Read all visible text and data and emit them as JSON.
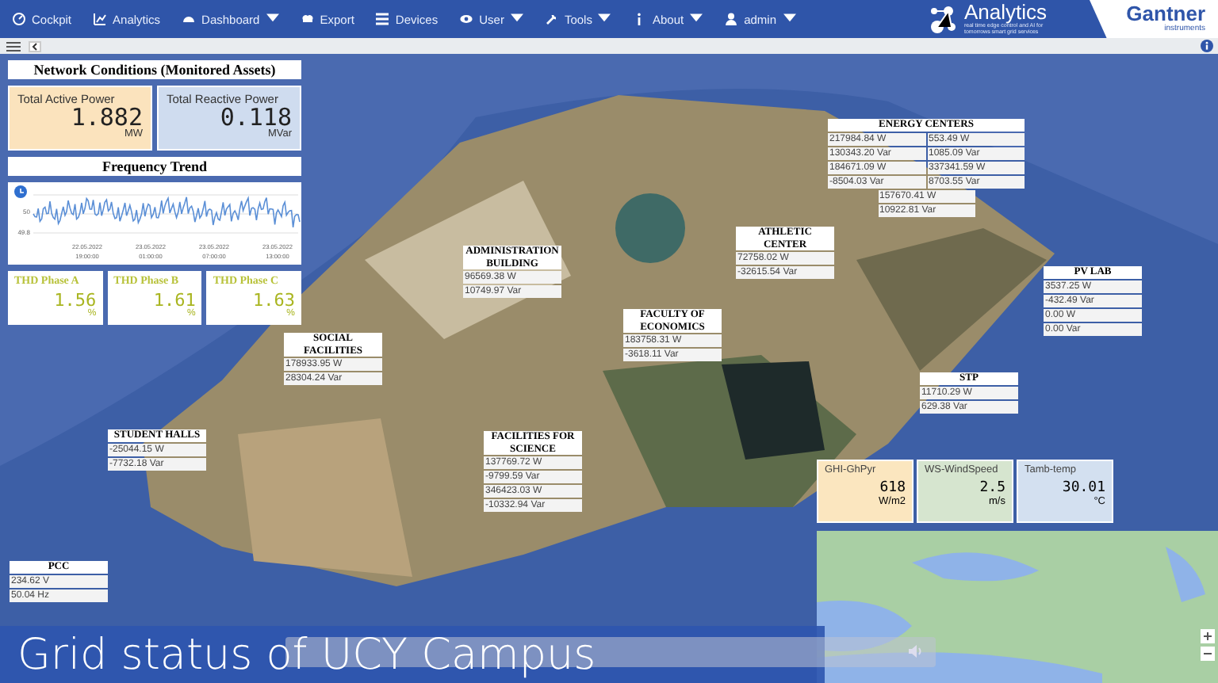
{
  "nav": {
    "items": [
      {
        "label": "Cockpit",
        "dropdown": false
      },
      {
        "label": "Analytics",
        "dropdown": false
      },
      {
        "label": "Dashboard",
        "dropdown": true
      },
      {
        "label": "Export",
        "dropdown": false
      },
      {
        "label": "Devices",
        "dropdown": false
      },
      {
        "label": "User",
        "dropdown": true
      },
      {
        "label": "Tools",
        "dropdown": true
      },
      {
        "label": "About",
        "dropdown": true
      },
      {
        "label": "admin",
        "dropdown": true
      }
    ],
    "analytics_logo": {
      "name": "Analytics",
      "tagline": "real time edge control and AI for tomorrows smart grid services"
    },
    "gantner_logo": {
      "name": "Gantner",
      "subtitle": "instruments"
    }
  },
  "network": {
    "title": "Network Conditions (Monitored Assets)",
    "tiles": [
      {
        "label": "Total Active Power",
        "value": "1.882",
        "unit": "MW",
        "color": "#fbe3bd"
      },
      {
        "label": "Total Reactive Power",
        "value": "0.118",
        "unit": "MVar",
        "color": "#cfdcef"
      }
    ]
  },
  "frequency": {
    "title": "Frequency Trend",
    "y_ticks": [
      "50",
      "49.8"
    ],
    "x_ticks": [
      {
        "date": "22.05.2022",
        "time": "19:00:00"
      },
      {
        "date": "23.05.2022",
        "time": "01:00:00"
      },
      {
        "date": "23.05.2022",
        "time": "07:00:00"
      },
      {
        "date": "23.05.2022",
        "time": "13:00:00"
      }
    ]
  },
  "thd": [
    {
      "label": "THD Phase A",
      "value": "1.56",
      "unit": "%"
    },
    {
      "label": "THD Phase B",
      "value": "1.61",
      "unit": "%"
    },
    {
      "label": "THD Phase C",
      "value": "1.63",
      "unit": "%"
    }
  ],
  "sites": [
    {
      "title": "ENERGY CENTERS",
      "readings": [
        [
          "217984.84 W",
          "130343.20 Var"
        ],
        [
          "553.49 W",
          "1085.09 Var"
        ],
        [
          "184671.09 W",
          "-8504.03 Var"
        ],
        [
          "337341.59 W",
          "8703.55 Var"
        ],
        [
          "157670.41 W",
          "10922.81 Var"
        ]
      ]
    },
    {
      "title": "ATHLETIC CENTER",
      "readings": [
        [
          "72758.02 W",
          "-32615.54 Var"
        ]
      ]
    },
    {
      "title": "ADMINISTRATION BUILDING",
      "readings": [
        [
          "96569.38 W",
          "10749.97 Var"
        ]
      ]
    },
    {
      "title": "PV LAB",
      "readings": [
        [
          "3537.25 W",
          "-432.49 Var"
        ],
        [
          "0.00 W",
          "0.00 Var"
        ]
      ]
    },
    {
      "title": "FACULTY OF ECONOMICS",
      "readings": [
        [
          "183758.31 W",
          "-3618.11 Var"
        ]
      ]
    },
    {
      "title": "SOCIAL FACILITIES",
      "readings": [
        [
          "178933.95 W",
          "28304.24 Var"
        ]
      ]
    },
    {
      "title": "STP",
      "readings": [
        [
          "11710.29 W",
          "629.38 Var"
        ]
      ]
    },
    {
      "title": "STUDENT HALLS",
      "readings": [
        [
          "-25044.15 W",
          "-7732.18 Var"
        ]
      ]
    },
    {
      "title": "FACILITIES FOR SCIENCE",
      "readings": [
        [
          "137769.72 W",
          "-9799.59 Var"
        ],
        [
          "346423.03 W",
          "-10332.94 Var"
        ]
      ]
    },
    {
      "title": "PCC",
      "readings": [
        [
          "234.62 V",
          "50.04 Hz"
        ]
      ]
    }
  ],
  "weather": [
    {
      "label": "GHI-GhPyr",
      "value": "618",
      "unit": "W/m2",
      "color": "#fbe6bf"
    },
    {
      "label": "WS-WindSpeed",
      "value": "2.5",
      "unit": "m/s",
      "color": "#d6e5cf"
    },
    {
      "label": "Tamb-temp",
      "value": "30.01",
      "unit": "°C",
      "color": "#d3e0f0"
    }
  ],
  "video": {
    "caption": "Grid status of UCY Campus"
  }
}
